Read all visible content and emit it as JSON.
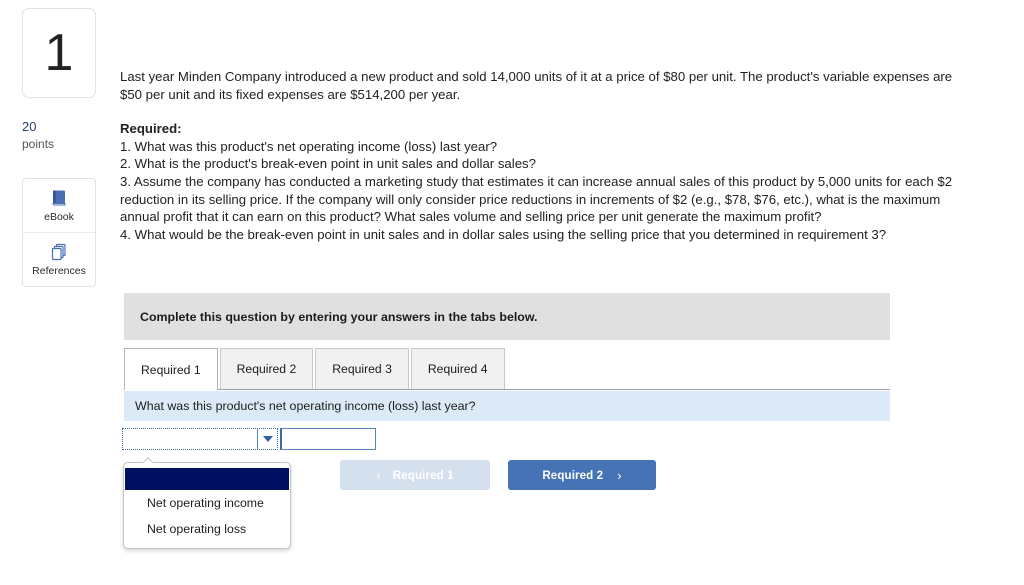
{
  "left_rail": {
    "question_number": "1",
    "points_value": "20",
    "points_label": "points",
    "tools": [
      {
        "icon": "ebook-icon",
        "label": "eBook"
      },
      {
        "icon": "references-icon",
        "label": "References"
      }
    ]
  },
  "question": {
    "paragraph1": "Last year Minden Company introduced a new product and sold 14,000 units of it at a price of $80 per unit. The product's variable expenses are $50 per unit and its fixed expenses are $514,200 per year.",
    "required_heading": "Required:",
    "items": [
      "1. What was this product's net operating income (loss) last year?",
      "2. What is the product's break-even point in unit sales and dollar sales?",
      "3. Assume the company has conducted a marketing study that estimates it can increase annual sales of this product by 5,000 units for each $2 reduction in its selling price. If the company will only consider price reductions in increments of $2 (e.g., $78, $76, etc.), what is the maximum annual profit that it can earn on this product? What sales volume and selling price per unit generate the maximum profit?",
      "4. What would be the break-even point in unit sales and in dollar sales using the selling price that you determined in requirement 3?"
    ]
  },
  "instruction_bar": {
    "text": "Complete this question by entering your answers in the tabs below."
  },
  "tabs": [
    {
      "label": "Required 1",
      "active": true
    },
    {
      "label": "Required 2",
      "active": false
    },
    {
      "label": "Required 3",
      "active": false
    },
    {
      "label": "Required 4",
      "active": false
    }
  ],
  "prompt_band": {
    "text": "What was this product's net operating income (loss) last year?"
  },
  "answer": {
    "select_value": "",
    "select_caret_icon": "chevron-down-icon",
    "amount_value": "",
    "amount_placeholder": ""
  },
  "dropdown": {
    "open": true,
    "highlighted_blank_option": "",
    "options": [
      "Net operating income",
      "Net operating loss"
    ]
  },
  "nav": {
    "prev_label": "Required 1",
    "prev_icon": "chevron-left-icon",
    "next_label": "Required 2",
    "next_icon": "chevron-right-icon"
  },
  "colors": {
    "primary_button": "#4573b5",
    "disabled_button": "#d5e0ef",
    "prompt_band": "#dceaf7",
    "instruction_bar": "#e0e0e0",
    "dropdown_highlight": "#001060",
    "points_accent": "#2b3f6c"
  }
}
